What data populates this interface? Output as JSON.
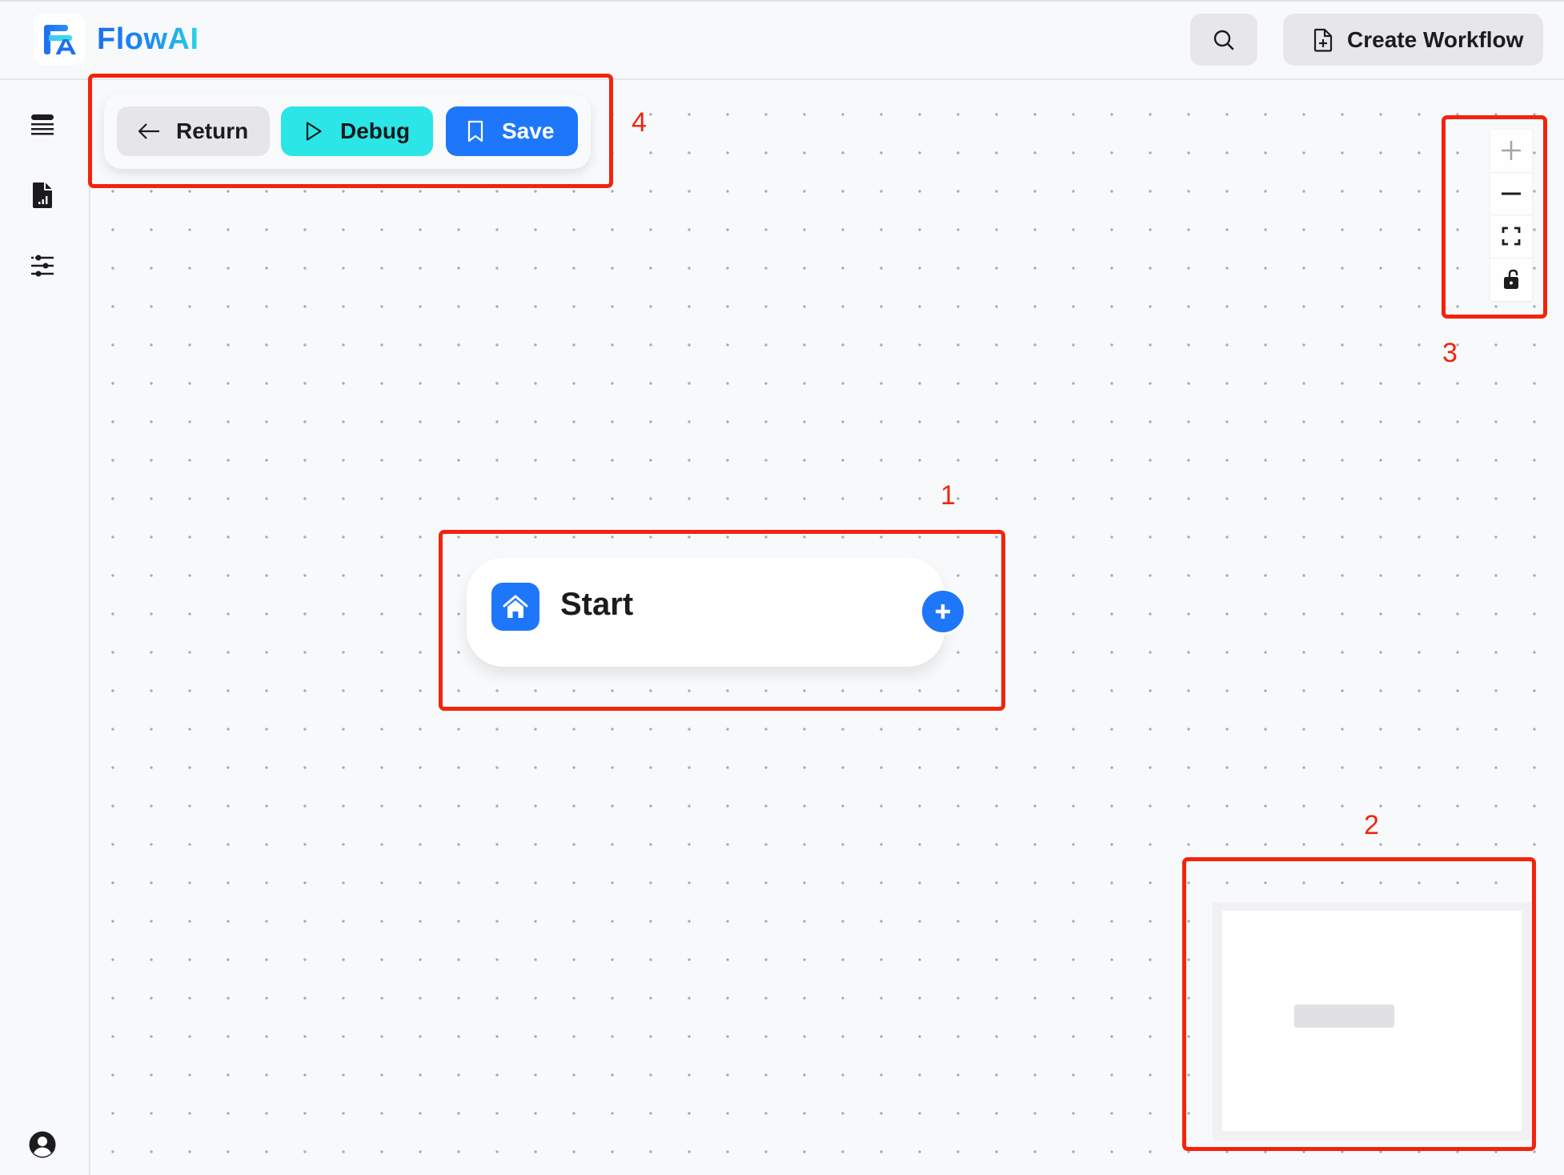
{
  "header": {
    "app_name": "FlowAI",
    "logo_icon": "flowai-logo-icon",
    "search_icon": "search-icon",
    "create_workflow_label": "Create Workflow",
    "create_workflow_icon": "file-plus-icon"
  },
  "sidebar": {
    "items": [
      {
        "icon": "list-icon",
        "name": "workflows"
      },
      {
        "icon": "file-chart-icon",
        "name": "reports"
      },
      {
        "icon": "sliders-icon",
        "name": "settings"
      }
    ],
    "user_icon": "user-circle-icon"
  },
  "toolbar": {
    "return_label": "Return",
    "debug_label": "Debug",
    "save_label": "Save"
  },
  "zoom_controls": {
    "zoom_in_icon": "plus-icon",
    "zoom_in_disabled": true,
    "zoom_out_icon": "minus-icon",
    "fit_view_icon": "fit-view-icon",
    "lock_icon": "unlock-icon"
  },
  "canvas": {
    "nodes": [
      {
        "title": "Start",
        "icon": "home-icon",
        "add_icon": "plus-circle-icon"
      }
    ]
  },
  "colors": {
    "primary": "#1e77fa",
    "debug": "#2ce5e6",
    "annotation": "#f4230c"
  },
  "annotations": [
    {
      "label": "1",
      "target": "start-node"
    },
    {
      "label": "2",
      "target": "minimap"
    },
    {
      "label": "3",
      "target": "zoom-controls"
    },
    {
      "label": "4",
      "target": "toolbar"
    }
  ]
}
